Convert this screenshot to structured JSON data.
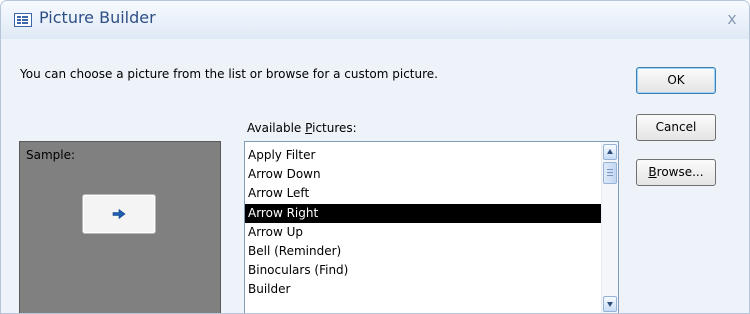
{
  "window": {
    "title": "Picture Builder",
    "close_glyph": "x"
  },
  "prompt_text": "You can choose a picture from the list or browse for a custom picture.",
  "available_label": {
    "before": "Available ",
    "accel": "P",
    "after": "ictures:"
  },
  "sample": {
    "label": "Sample:",
    "preview_icon": "arrow-right-icon"
  },
  "list": {
    "items": [
      "Apply Filter",
      "Arrow Down",
      "Arrow Left",
      "Arrow Right",
      "Arrow Up",
      "Bell (Reminder)",
      "Binoculars (Find)",
      "Builder"
    ],
    "selected": "Arrow Right"
  },
  "buttons": {
    "ok": "OK",
    "cancel": "Cancel",
    "browse": {
      "accel": "B",
      "after": "rowse..."
    }
  },
  "colors": {
    "selection": "#000000",
    "sample_bg": "#808080",
    "title_text": "#2e4f86",
    "arrow": "#1f5fb0"
  }
}
